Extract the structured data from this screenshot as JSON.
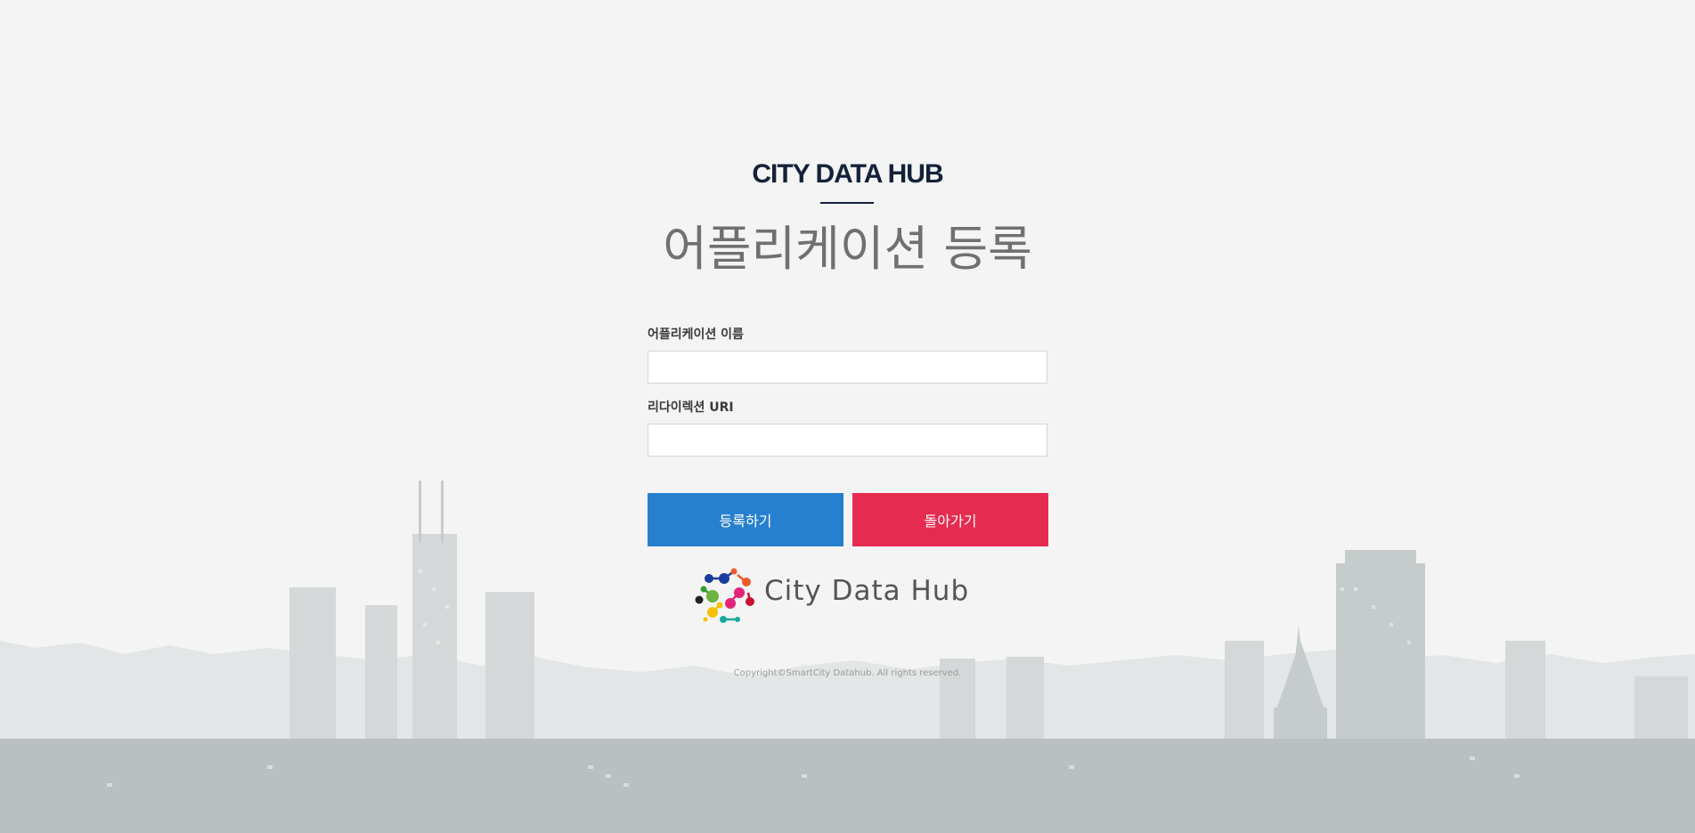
{
  "brand": {
    "name": "CITY DATA HUB"
  },
  "page": {
    "title": "어플리케이션 등록"
  },
  "form": {
    "app_name_label": "어플리케이션 이름",
    "app_name_value": "",
    "redirect_uri_label": "리다이렉션 URI",
    "redirect_uri_value": ""
  },
  "buttons": {
    "register_label": "등록하기",
    "back_label": "돌아가기"
  },
  "logo": {
    "text": "City Data Hub",
    "icon": "molecule-logo-icon"
  },
  "footer": {
    "copyright": "Copyright©SmartCity Datahub. All rights reserved."
  },
  "colors": {
    "background": "#f4f4f4",
    "brand": "#13213a",
    "register_button": "#2780cf",
    "back_button": "#e62b50"
  }
}
